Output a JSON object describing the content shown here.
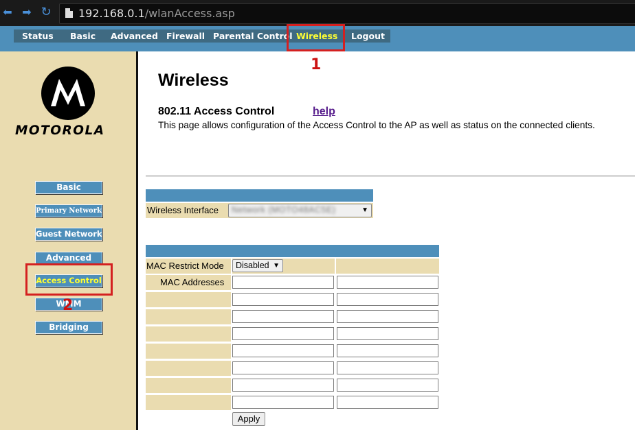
{
  "browser": {
    "url_host": "192.168.0.1",
    "url_path": "/wlanAccess.asp"
  },
  "top_menu": {
    "items": [
      "Status",
      "Basic",
      "Advanced",
      "Firewall",
      "Parental Control",
      "Wireless",
      "Logout"
    ],
    "active": "Wireless"
  },
  "annotations": {
    "one": "1",
    "two": "2",
    "color": "#d42020"
  },
  "sidebar": {
    "logo_text": "MOTOROLA",
    "buttons": [
      "Basic",
      "Primary Network",
      "Guest Network",
      "Advanced",
      "Access Control",
      "WMM",
      "Bridging"
    ],
    "active": "Access Control"
  },
  "main": {
    "title": "Wireless",
    "section_title": "802.11 Access Control",
    "help_link": "help",
    "description": "This page allows configuration of the Access Control to the AP as well as status on the connected clients."
  },
  "interface_table": {
    "label": "Wireless Interface",
    "value": "Network (MOTO48AC5E)"
  },
  "mac_table": {
    "restrict_label": "MAC Restrict Mode",
    "restrict_value": "Disabled",
    "addresses_label": "MAC Addresses",
    "address_values": [
      "",
      "",
      "",
      "",
      "",
      "",
      "",
      "",
      "",
      "",
      "",
      "",
      "",
      "",
      "",
      ""
    ]
  },
  "apply_label": "Apply",
  "colors": {
    "menu_band": "#4e8fba",
    "menu_strip": "#3f6a82",
    "sidebar": "#eadcb0",
    "active_text": "#ffff33"
  }
}
